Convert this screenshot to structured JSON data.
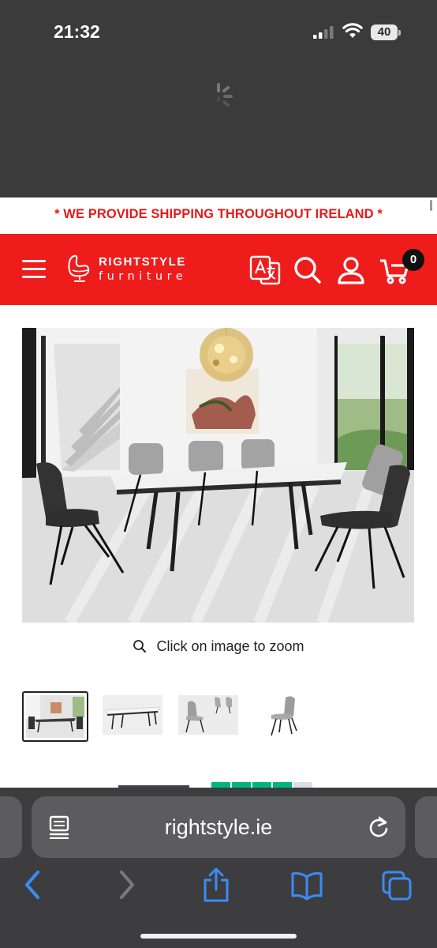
{
  "status_bar": {
    "time": "21:32",
    "battery": "40",
    "signal_icon": "cellular-signal-icon",
    "wifi_icon": "wifi-icon"
  },
  "loading": {
    "icon": "loading-spinner-icon"
  },
  "shipping_banner": {
    "text": "* WE PROVIDE SHIPPING THROUGHOUT IRELAND *"
  },
  "header": {
    "brand_top": "RIGHTSTYLE",
    "brand_bottom": "furniture",
    "cart_count": "0",
    "icons": [
      "menu-icon",
      "egg-chair-logo-icon",
      "translate-icon",
      "search-icon",
      "account-icon",
      "cart-icon"
    ],
    "accent_color": "#ef1c1c"
  },
  "product": {
    "zoom_hint": "Click on image to zoom",
    "thumbnails": [
      "dining-room-set",
      "extending-table",
      "chairs-pair",
      "single-chair"
    ]
  },
  "browser": {
    "url": "rightstyle.ie",
    "icons": [
      "reader-mode-icon",
      "reload-icon",
      "back-icon",
      "forward-icon",
      "share-icon",
      "bookmarks-icon",
      "tabs-icon"
    ],
    "link_color": "#3a8cf6"
  }
}
